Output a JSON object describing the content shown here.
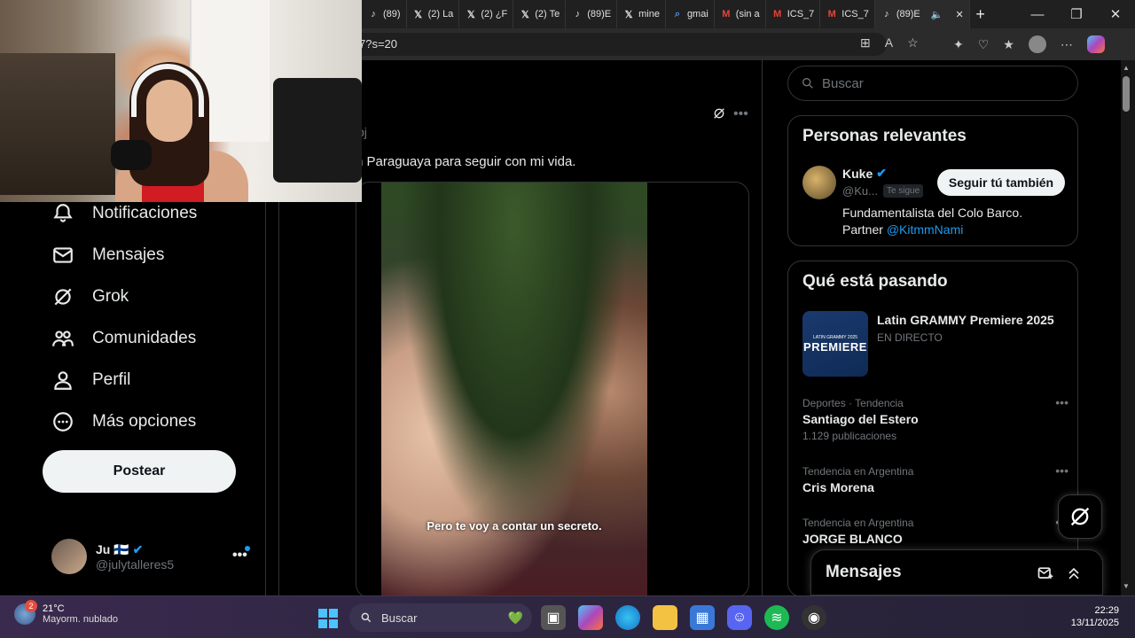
{
  "browser": {
    "tabs": [
      {
        "icon": "tiktok-icon",
        "label": "(89)"
      },
      {
        "icon": "x-icon",
        "label": "(2) La"
      },
      {
        "icon": "x-icon",
        "label": "(2) ¿F"
      },
      {
        "icon": "x-icon",
        "label": "(2) Te"
      },
      {
        "icon": "tiktok-icon",
        "label": "(89)E"
      },
      {
        "icon": "x-icon",
        "label": "mine"
      },
      {
        "icon": "search-icon",
        "label": "gmai"
      },
      {
        "icon": "gmail-icon",
        "label": "(sin a"
      },
      {
        "icon": "gmail-icon",
        "label": "ICS_7"
      },
      {
        "icon": "gmail-icon",
        "label": "ICS_7"
      },
      {
        "icon": "tiktok-icon",
        "label": "(89)E"
      }
    ],
    "url": "7?s=20",
    "new_tab": "+",
    "minimize": "—",
    "restore": "❐",
    "close": "✕"
  },
  "nav": {
    "notifications": "Notificaciones",
    "messages": "Mensajes",
    "grok": "Grok",
    "communities": "Comunidades",
    "profile": "Perfil",
    "more": "Más opciones",
    "post_button": "Postear"
  },
  "account": {
    "name": "Ju 🇫🇮",
    "handle": "@julytalleres5",
    "more": "•••"
  },
  "post": {
    "meta": "bj",
    "text": "n Paraguaya para seguir con mi vida.",
    "video_caption": "Pero te voy a contar un secreto.",
    "more": "•••"
  },
  "right": {
    "search_placeholder": "Buscar",
    "relevant_title": "Personas relevantes",
    "relevant": {
      "name": "Kuke",
      "handle": "@Ku...",
      "follows_you": "Te sigue",
      "follow_button": "Seguir tú también",
      "bio": "Fundamentalista del Colo Barco. Partner ",
      "bio_link": "@KitmmNami"
    },
    "trends_title": "Qué está pasando",
    "live": {
      "title": "Latin GRAMMY Premiere 2025",
      "status": "EN DIRECTO",
      "img_small": "LATIN GRAMMY 2025",
      "img_big": "PREMIERE"
    },
    "trends": [
      {
        "context": "Deportes · Tendencia",
        "title": "Santiago del Estero",
        "count": "1.129 publicaciones"
      },
      {
        "context": "Tendencia en Argentina",
        "title": "Cris Morena",
        "count": ""
      },
      {
        "context": "Tendencia en Argentina",
        "title": "JORGE BLANCO",
        "count": ""
      }
    ],
    "messages_dock": "Mensajes"
  },
  "taskbar": {
    "weather_temp": "21°C",
    "weather_desc": "Mayorm. nublado",
    "weather_badge": "2",
    "search": "Buscar",
    "time": "22:29",
    "date": "13/11/2025"
  },
  "colors": {
    "accent": "#1d9bf0",
    "background": "#000000",
    "border": "#2f3336"
  }
}
